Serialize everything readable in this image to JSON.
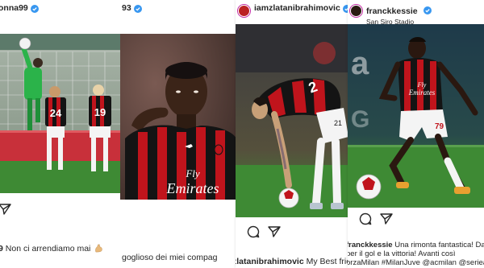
{
  "posts": [
    {
      "username": "onna99",
      "verified": true,
      "caption_user": "9",
      "caption_text": "Non ci arrendiamo mai",
      "caption_emoji": "flexed-biceps-icon",
      "jerseys": [
        "24",
        "19"
      ]
    },
    {
      "username": "93",
      "verified": true,
      "caption_text": "goglioso dei miei compag",
      "jersey_sponsor_top": "Fly",
      "jersey_sponsor_bottom": "Emirates"
    },
    {
      "username": "iamzlatanibrahimovic",
      "verified": true,
      "caption_user": "zlatanibrahimovic",
      "caption_text": "My Best frien",
      "jersey_number": "21"
    },
    {
      "username": "franckkessie",
      "verified": true,
      "location": "San Siro Stadio",
      "caption_user": "franckkessie",
      "caption_text_line1": "Una rimonta fantastica! Davvero",
      "caption_text_line2": "per il gol e la vittoria! Avanti così",
      "caption_text_line3": "orzaMilan #MilanJuve @acmilan @seriea",
      "jersey_number": "79",
      "jersey_sponsor_top": "Fly",
      "jersey_sponsor_bottom": "Emirates"
    }
  ],
  "colors": {
    "milan_red": "#c0141c",
    "milan_black": "#141414",
    "verified_blue": "#3897f0",
    "pitch_green": "#3e8a34"
  }
}
